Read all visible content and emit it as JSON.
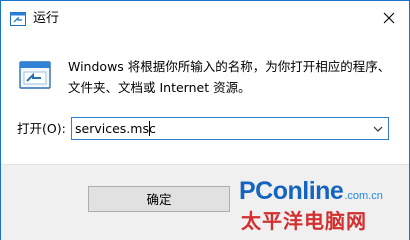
{
  "window": {
    "title": "运行",
    "close_icon": "close-icon"
  },
  "content": {
    "description_line1": "Windows 将根据你所输入的名称，为你打开相应的程序、",
    "description_line2": "文件夹、文档或 Internet 资源。",
    "open_label": "打开(O):",
    "input_value": "services.msc"
  },
  "buttons": {
    "ok_label": "确定"
  },
  "watermark": {
    "brand": "PConline",
    "domain": ".com.cn",
    "chinese": "太平洋电脑网"
  },
  "colors": {
    "accent": "#1a73c7",
    "brand_blue": "#1565c0",
    "brand_red": "#d32f2f"
  }
}
